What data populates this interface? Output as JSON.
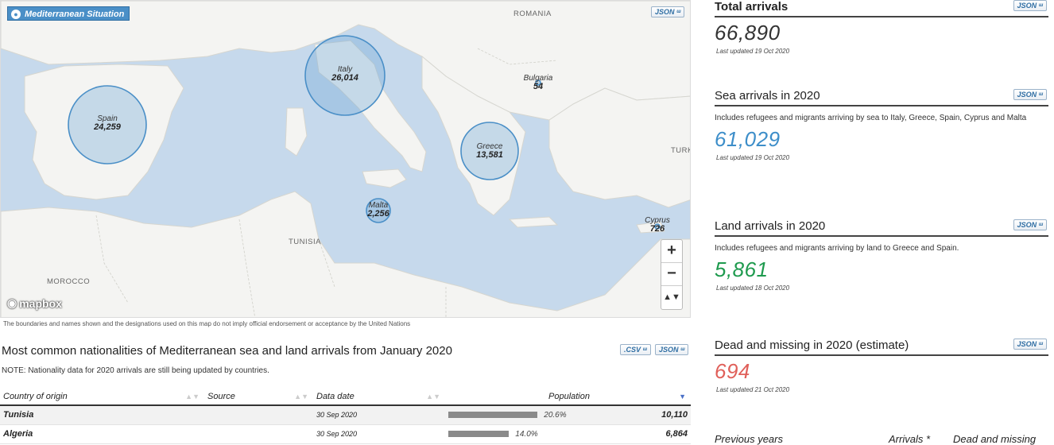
{
  "map": {
    "title": "Mediterranean Situation",
    "json_label": "JSON",
    "country_labels": [
      "ROMANIA",
      "TURK",
      "TUNISIA",
      "MOROCCO"
    ],
    "bubbles": [
      {
        "name": "Spain",
        "value": "24,259"
      },
      {
        "name": "Italy",
        "value": "26,014"
      },
      {
        "name": "Bulgaria",
        "value": "54"
      },
      {
        "name": "Greece",
        "value": "13,581"
      },
      {
        "name": "Malta",
        "value": "2,256"
      },
      {
        "name": "Cyprus",
        "value": "726"
      }
    ],
    "zoom_in": "+",
    "zoom_out": "−",
    "compass": "▲▼",
    "attribution": "mapbox",
    "disclaimer": "The boundaries and names shown and the designations used on this map do not imply official endorsement or acceptance by the United Nations"
  },
  "nationalities": {
    "title": "Most common nationalities of Mediterranean sea and land arrivals from January 2020",
    "csv_label": ".CSV",
    "json_label": "JSON",
    "note": "NOTE: Nationality data for 2020 arrivals are still being updated by countries.",
    "columns": [
      "Country of origin",
      "Source",
      "Data date",
      "Population"
    ],
    "rows": [
      {
        "country": "Tunisia",
        "source": "",
        "date": "30 Sep 2020",
        "pct": "20.6%",
        "pct_value": 20.6,
        "population": "10,110"
      },
      {
        "country": "Algeria",
        "source": "",
        "date": "30 Sep 2020",
        "pct": "14.0%",
        "pct_value": 14.0,
        "population": "6,864"
      }
    ]
  },
  "stats": {
    "total": {
      "title": "Total arrivals",
      "value": "66,890",
      "updated": "Last updated 19 Oct 2020",
      "json_label": "JSON",
      "color": "#333333"
    },
    "sea": {
      "title": "Sea arrivals in 2020",
      "desc": "Includes refugees and migrants arriving by sea to Italy, Greece, Spain, Cyprus and Malta",
      "value": "61,029",
      "updated": "Last updated 19 Oct 2020",
      "json_label": "JSON",
      "color": "#3d8ec9"
    },
    "land": {
      "title": "Land arrivals in 2020",
      "desc": "Includes refugees and migrants arriving by land to Greece and Spain.",
      "value": "5,861",
      "updated": "Last updated 18 Oct 2020",
      "json_label": "JSON",
      "color": "#1e9a4e"
    },
    "dead": {
      "title": "Dead and missing in 2020 (estimate)",
      "value": "694",
      "updated": "Last updated 21 Oct 2020",
      "json_label": "JSON",
      "color": "#e0605a"
    }
  },
  "previous": {
    "col1": "Previous years",
    "col2": "Arrivals *",
    "col3": "Dead and missing"
  }
}
